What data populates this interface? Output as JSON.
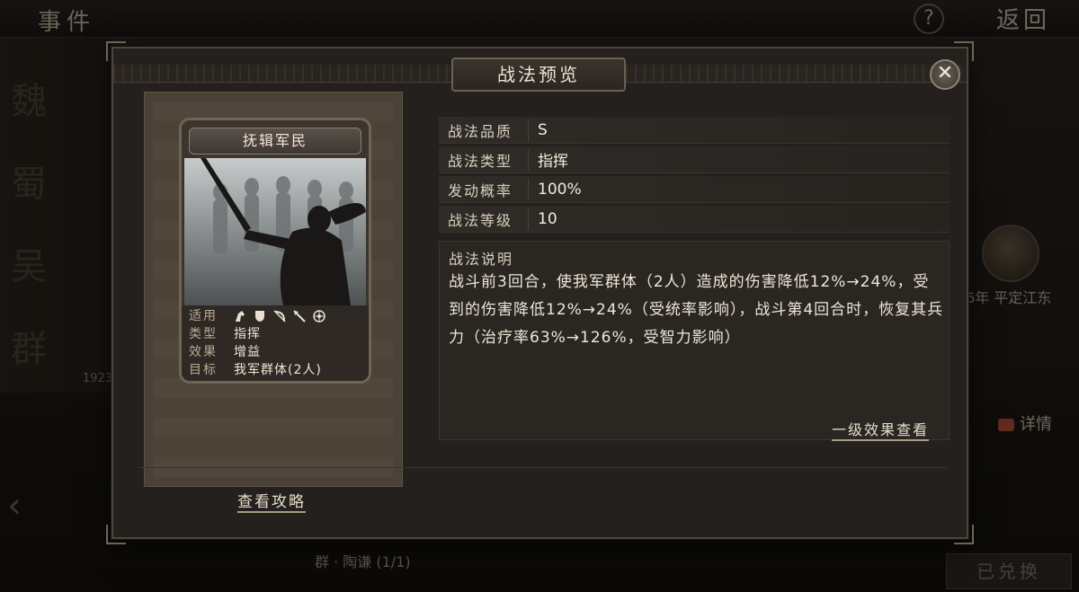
{
  "background": {
    "top_title": "事件",
    "help_icon": "?",
    "back_label": "返回",
    "factions": [
      "魏",
      "蜀",
      "吴",
      "群"
    ],
    "left_number": "1923",
    "right_event_text": "6年 平定江东",
    "detail_label": "详情",
    "bottom_text": "群 · 陶谦 (1/1)",
    "exchanged_label": "已兑换"
  },
  "modal": {
    "title": "战法预览",
    "close_icon": "✕",
    "card": {
      "name": "抚辑军民",
      "rows": [
        {
          "label": "适用",
          "value": ""
        },
        {
          "label": "类型",
          "value": "指挥"
        },
        {
          "label": "效果",
          "value": "增益"
        },
        {
          "label": "目标",
          "value": "我军群体(2人)"
        }
      ],
      "troop_icons": [
        "cavalry-icon",
        "shield-icon",
        "bow-icon",
        "spear-icon",
        "wheel-icon"
      ]
    },
    "properties": [
      {
        "label": "战法品质",
        "value": "S"
      },
      {
        "label": "战法类型",
        "value": "指挥"
      },
      {
        "label": "发动概率",
        "value": "100%"
      },
      {
        "label": "战法等级",
        "value": "10"
      }
    ],
    "description": {
      "label": "战法说明",
      "text": "战斗前3回合，使我军群体（2人）造成的伤害降低12%→24%，受到的伤害降低12%→24%（受统率影响），战斗第4回合时，恢复其兵力（治疗率63%→126%，受智力影响）",
      "level_link": "一级效果查看"
    },
    "strategy_link": "查看攻略"
  },
  "colors": {
    "accent": "#a89c86",
    "panel": "#23201d",
    "text": "#efe6d6"
  }
}
